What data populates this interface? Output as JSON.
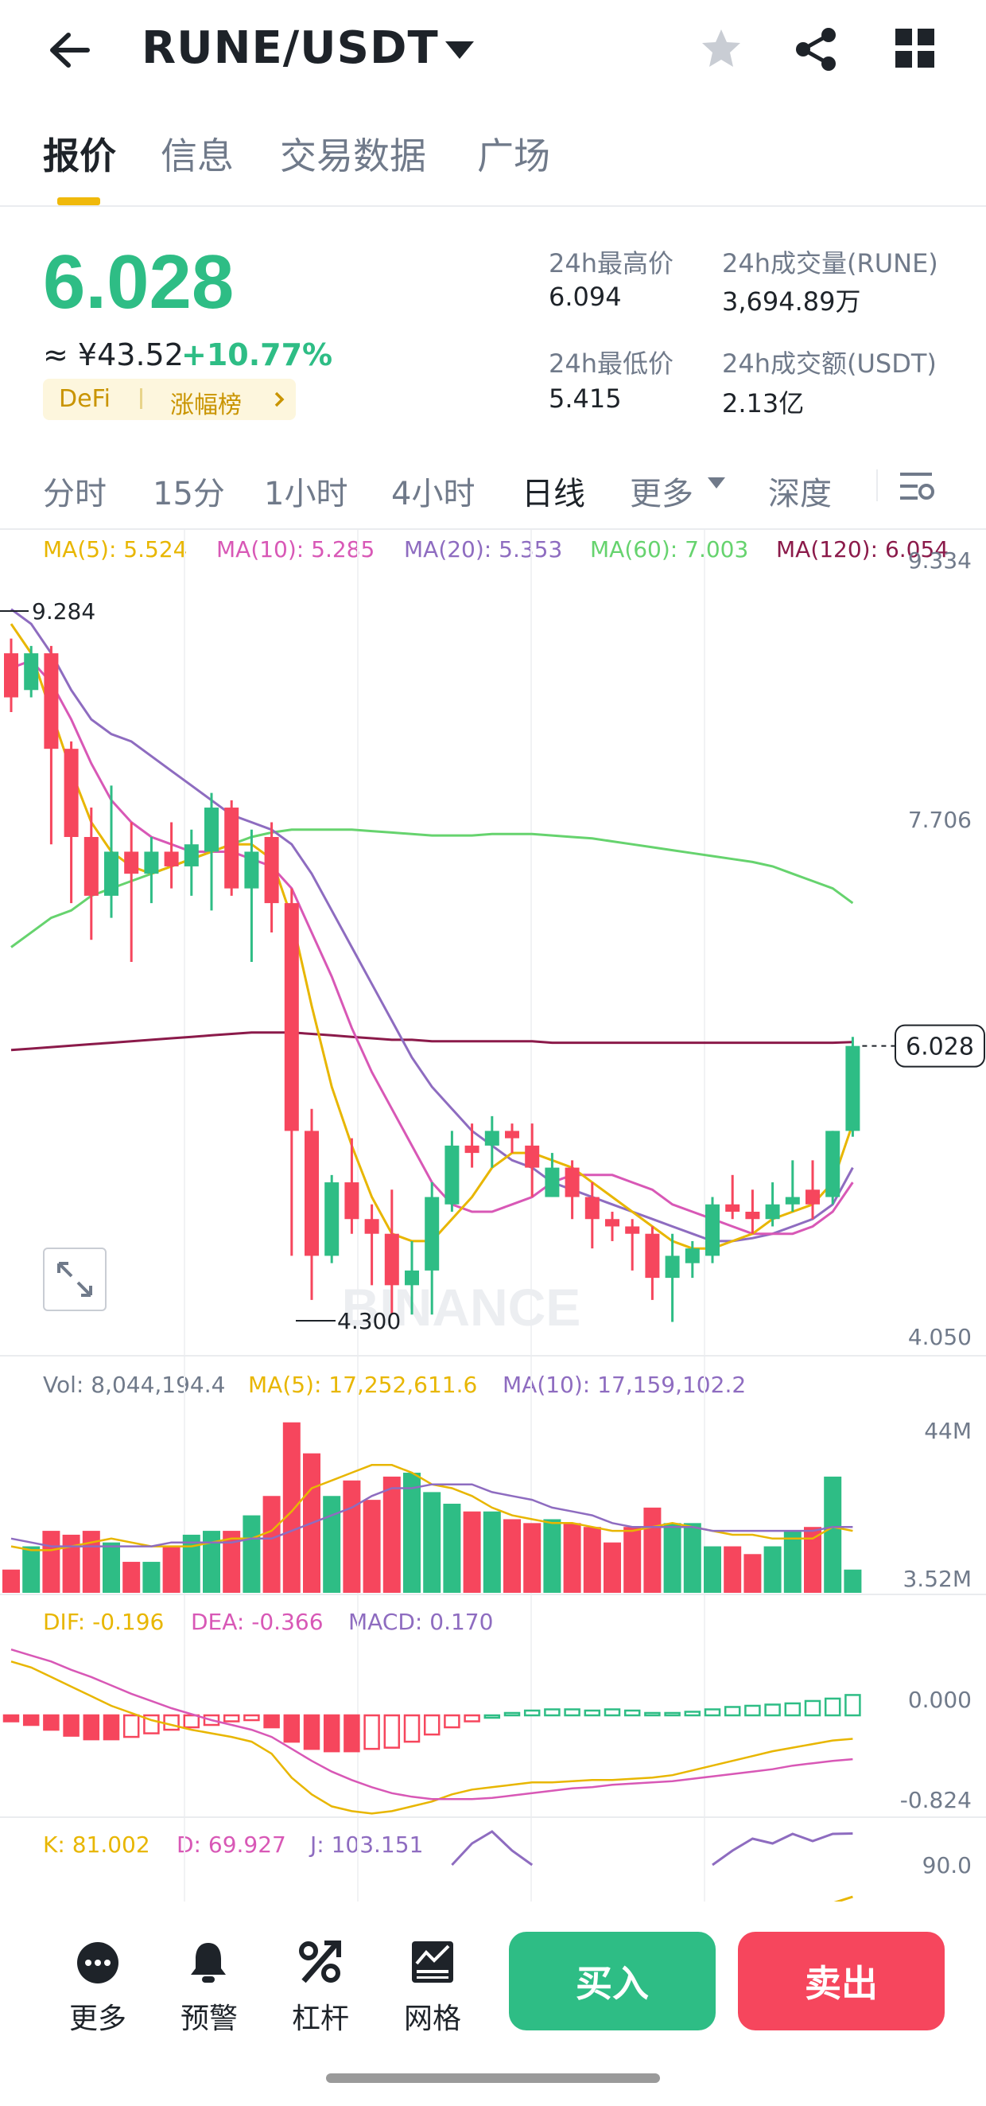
{
  "header": {
    "pair": "RUNE/USDT",
    "icons": [
      "back-arrow-icon",
      "dropdown-icon",
      "star-icon",
      "share-icon",
      "grid-icon"
    ]
  },
  "tabs": [
    {
      "label": "报价",
      "active": true
    },
    {
      "label": "信息",
      "active": false
    },
    {
      "label": "交易数据",
      "active": false
    },
    {
      "label": "广场",
      "active": false
    }
  ],
  "ticker": {
    "price": "6.028",
    "fiat": "≈ ¥43.52",
    "change": "+10.77%",
    "tag1": "DeFi",
    "tag2": "涨幅榜",
    "high_label": "24h最高价",
    "high": "6.094",
    "low_label": "24h最低价",
    "low": "5.415",
    "vol_label": "24h成交量(RUNE)",
    "vol": "3,694.89万",
    "amt_label": "24h成交额(USDT)",
    "amt": "2.13亿"
  },
  "intervals": [
    {
      "label": "分时"
    },
    {
      "label": "15分"
    },
    {
      "label": "1小时"
    },
    {
      "label": "4小时"
    },
    {
      "label": "日线",
      "active": true
    },
    {
      "label": "更多"
    },
    {
      "label": "深度"
    }
  ],
  "legend": {
    "ma5": "MA(5): 5.524",
    "ma10": "MA(10): 5.285",
    "ma20": "MA(20): 5.353",
    "ma60": "MA(60): 7.003",
    "ma120": "MA(120): 6.054",
    "vol": "Vol: 8,044,194.4",
    "vma5": "MA(5): 17,252,611.6",
    "vma10": "MA(10): 17,159,102.2",
    "dif": "DIF: -0.196",
    "dea": "DEA: -0.366",
    "macd": "MACD: 0.170",
    "k": "K: 81.002",
    "d": "D: 69.927",
    "j": "J: 103.151"
  },
  "colors": {
    "up": "#2ebd85",
    "down": "#f6465d",
    "ma5": "#e8b600",
    "ma10": "#d858b6",
    "ma20": "#8e6cc0",
    "ma60": "#66d36e",
    "ma120": "#8b1a4a",
    "accent": "#f0b90b"
  },
  "chart_data": {
    "type": "candlestick",
    "price_axis": {
      "ticks": [
        "9.334",
        "7.706",
        "6.028",
        "4.050"
      ],
      "top": "9.334",
      "bottom": "4.050"
    },
    "annotations": {
      "high": "9.284",
      "low": "4.300",
      "last": "6.028",
      "watermark": "BINANCE"
    },
    "candles": [
      {
        "o": 8.7,
        "h": 8.8,
        "c": 8.4,
        "l": 8.3
      },
      {
        "o": 8.45,
        "h": 8.75,
        "c": 8.7,
        "l": 8.4
      },
      {
        "o": 8.7,
        "h": 8.75,
        "c": 8.05,
        "l": 7.4
      },
      {
        "o": 8.05,
        "h": 8.1,
        "c": 7.45,
        "l": 7.0
      },
      {
        "o": 7.45,
        "h": 7.65,
        "c": 7.05,
        "l": 6.75
      },
      {
        "o": 7.05,
        "h": 7.8,
        "c": 7.35,
        "l": 6.9
      },
      {
        "o": 7.35,
        "h": 7.55,
        "c": 7.2,
        "l": 6.6
      },
      {
        "o": 7.2,
        "h": 7.45,
        "c": 7.35,
        "l": 7.0
      },
      {
        "o": 7.35,
        "h": 7.55,
        "c": 7.25,
        "l": 7.1
      },
      {
        "o": 7.25,
        "h": 7.5,
        "c": 7.4,
        "l": 7.05
      },
      {
        "o": 7.35,
        "h": 7.75,
        "c": 7.65,
        "l": 6.95
      },
      {
        "o": 7.65,
        "h": 7.7,
        "c": 7.1,
        "l": 7.05
      },
      {
        "o": 7.1,
        "h": 7.5,
        "c": 7.35,
        "l": 6.6
      },
      {
        "o": 7.45,
        "h": 7.55,
        "c": 7.0,
        "l": 6.8
      },
      {
        "o": 7.0,
        "h": 7.1,
        "c": 5.45,
        "l": 4.6
      },
      {
        "o": 5.45,
        "h": 5.6,
        "c": 4.6,
        "l": 4.3
      },
      {
        "o": 4.6,
        "h": 5.15,
        "c": 5.1,
        "l": 4.55
      },
      {
        "o": 5.1,
        "h": 5.4,
        "c": 4.85,
        "l": 4.75
      },
      {
        "o": 4.85,
        "h": 4.95,
        "c": 4.75,
        "l": 4.4
      },
      {
        "o": 4.75,
        "h": 5.05,
        "c": 4.4,
        "l": 4.2
      },
      {
        "o": 4.4,
        "h": 4.7,
        "c": 4.5,
        "l": 4.2
      },
      {
        "o": 4.5,
        "h": 5.1,
        "c": 5.0,
        "l": 4.2
      },
      {
        "o": 4.95,
        "h": 5.45,
        "c": 5.35,
        "l": 4.9
      },
      {
        "o": 5.35,
        "h": 5.5,
        "c": 5.3,
        "l": 5.2
      },
      {
        "o": 5.35,
        "h": 5.55,
        "c": 5.45,
        "l": 5.2
      },
      {
        "o": 5.45,
        "h": 5.5,
        "c": 5.4,
        "l": 5.3
      },
      {
        "o": 5.35,
        "h": 5.5,
        "c": 5.2,
        "l": 5.0
      },
      {
        "o": 5.0,
        "h": 5.3,
        "c": 5.2,
        "l": 5.0
      },
      {
        "o": 5.2,
        "h": 5.25,
        "c": 5.0,
        "l": 4.85
      },
      {
        "o": 5.0,
        "h": 5.1,
        "c": 4.85,
        "l": 4.65
      },
      {
        "o": 4.85,
        "h": 4.9,
        "c": 4.8,
        "l": 4.7
      },
      {
        "o": 4.8,
        "h": 4.85,
        "c": 4.75,
        "l": 4.5
      },
      {
        "o": 4.75,
        "h": 4.8,
        "c": 4.45,
        "l": 4.3
      },
      {
        "o": 4.45,
        "h": 4.75,
        "c": 4.6,
        "l": 4.15
      },
      {
        "o": 4.55,
        "h": 4.7,
        "c": 4.65,
        "l": 4.45
      },
      {
        "o": 4.6,
        "h": 5.0,
        "c": 4.95,
        "l": 4.55
      },
      {
        "o": 4.95,
        "h": 5.15,
        "c": 4.9,
        "l": 4.85
      },
      {
        "o": 4.9,
        "h": 5.05,
        "c": 4.85,
        "l": 4.75
      },
      {
        "o": 4.85,
        "h": 5.1,
        "c": 4.95,
        "l": 4.8
      },
      {
        "o": 4.95,
        "h": 5.25,
        "c": 5.0,
        "l": 4.9
      },
      {
        "o": 5.05,
        "h": 5.25,
        "c": 4.95,
        "l": 4.85
      },
      {
        "o": 5.0,
        "h": 5.45,
        "c": 5.45,
        "l": 4.95
      },
      {
        "o": 5.45,
        "h": 6.09,
        "c": 6.028,
        "l": 5.41
      }
    ],
    "ma5": [
      8.9,
      8.7,
      8.3,
      7.9,
      7.55,
      7.35,
      7.25,
      7.2,
      7.25,
      7.3,
      7.35,
      7.4,
      7.4,
      7.3,
      6.9,
      6.3,
      5.75,
      5.35,
      5.0,
      4.75,
      4.7,
      4.7,
      4.85,
      5.0,
      5.2,
      5.3,
      5.3,
      5.25,
      5.2,
      5.1,
      5.0,
      4.9,
      4.8,
      4.7,
      4.65,
      4.65,
      4.7,
      4.75,
      4.85,
      4.9,
      4.95,
      5.1,
      5.5
    ],
    "ma10": [
      8.6,
      8.65,
      8.5,
      8.25,
      7.95,
      7.7,
      7.55,
      7.45,
      7.4,
      7.35,
      7.35,
      7.35,
      7.3,
      7.25,
      7.1,
      6.8,
      6.5,
      6.15,
      5.85,
      5.6,
      5.35,
      5.1,
      4.95,
      4.9,
      4.9,
      4.95,
      5.0,
      5.1,
      5.15,
      5.15,
      5.15,
      5.1,
      5.05,
      4.95,
      4.9,
      4.85,
      4.8,
      4.75,
      4.75,
      4.75,
      4.8,
      4.9,
      5.1
    ],
    "ma20": [
      9.0,
      8.9,
      8.7,
      8.45,
      8.25,
      8.15,
      8.1,
      8.0,
      7.9,
      7.8,
      7.7,
      7.6,
      7.55,
      7.5,
      7.4,
      7.2,
      6.95,
      6.7,
      6.45,
      6.2,
      5.95,
      5.75,
      5.6,
      5.45,
      5.35,
      5.25,
      5.2,
      5.1,
      5.05,
      5.0,
      4.95,
      4.9,
      4.85,
      4.8,
      4.75,
      4.7,
      4.7,
      4.72,
      4.75,
      4.8,
      4.85,
      4.95,
      5.2
    ],
    "ma60": [
      6.7,
      6.8,
      6.9,
      6.95,
      7.05,
      7.1,
      7.15,
      7.2,
      7.25,
      7.3,
      7.35,
      7.4,
      7.45,
      7.48,
      7.5,
      7.5,
      7.5,
      7.5,
      7.49,
      7.48,
      7.47,
      7.46,
      7.46,
      7.46,
      7.47,
      7.47,
      7.47,
      7.46,
      7.45,
      7.44,
      7.42,
      7.4,
      7.38,
      7.36,
      7.34,
      7.32,
      7.3,
      7.28,
      7.25,
      7.2,
      7.15,
      7.1,
      7.0
    ],
    "ma120": [
      6.0,
      6.01,
      6.02,
      6.03,
      6.04,
      6.05,
      6.06,
      6.07,
      6.08,
      6.09,
      6.1,
      6.11,
      6.12,
      6.12,
      6.12,
      6.11,
      6.1,
      6.09,
      6.08,
      6.07,
      6.07,
      6.06,
      6.06,
      6.06,
      6.06,
      6.06,
      6.06,
      6.05,
      6.05,
      6.05,
      6.05,
      6.05,
      6.05,
      6.05,
      6.05,
      6.05,
      6.05,
      6.05,
      6.05,
      6.05,
      6.05,
      6.05,
      6.054
    ],
    "volume_axis": {
      "top": "44M",
      "bottom": "3.52M"
    },
    "volume": [
      6,
      12,
      16,
      15,
      16,
      13,
      8,
      8,
      12,
      15,
      16,
      16,
      20,
      25,
      44,
      36,
      25,
      29,
      24,
      30,
      31,
      26,
      23,
      21,
      21,
      19,
      18,
      19,
      18,
      17,
      13,
      17,
      22,
      18,
      18,
      12,
      12,
      10,
      12,
      16,
      17,
      30,
      6
    ],
    "vol_ma5": [
      12,
      11,
      11,
      12,
      13,
      14,
      13,
      12,
      12,
      12,
      13,
      14,
      14,
      16,
      21,
      27,
      29,
      31,
      33,
      33,
      31,
      28,
      27,
      25,
      22,
      20,
      19,
      18,
      18,
      17,
      16,
      16,
      17,
      18,
      17,
      16,
      15,
      15,
      14,
      14,
      14,
      17,
      16
    ],
    "vol_ma10": [
      14,
      13,
      12,
      12,
      12,
      12,
      12,
      12,
      13,
      13,
      13,
      13,
      14,
      14,
      16,
      18,
      20,
      22,
      25,
      27,
      27,
      28,
      28,
      28,
      26,
      25,
      24,
      22,
      21,
      20,
      18,
      17,
      17,
      17,
      17,
      16,
      16,
      16,
      16,
      16,
      16,
      17,
      17
    ],
    "macd_axis": {
      "top": "0.000",
      "bottom": "-0.824"
    },
    "macd_hist": [
      -0.05,
      -0.08,
      -0.12,
      -0.17,
      -0.2,
      -0.2,
      -0.18,
      -0.15,
      -0.12,
      -0.1,
      -0.08,
      -0.05,
      -0.04,
      -0.1,
      -0.22,
      -0.28,
      -0.3,
      -0.3,
      -0.28,
      -0.27,
      -0.22,
      -0.16,
      -0.1,
      -0.05,
      0.0,
      0.02,
      0.04,
      0.05,
      0.05,
      0.04,
      0.05,
      0.04,
      0.02,
      0.02,
      0.03,
      0.05,
      0.07,
      0.08,
      0.09,
      0.1,
      0.12,
      0.14,
      0.17
    ],
    "dif": [
      0.45,
      0.4,
      0.32,
      0.24,
      0.16,
      0.08,
      0.02,
      -0.04,
      -0.08,
      -0.12,
      -0.15,
      -0.18,
      -0.22,
      -0.32,
      -0.52,
      -0.66,
      -0.76,
      -0.8,
      -0.82,
      -0.8,
      -0.76,
      -0.72,
      -0.66,
      -0.62,
      -0.6,
      -0.58,
      -0.56,
      -0.56,
      -0.55,
      -0.54,
      -0.54,
      -0.53,
      -0.52,
      -0.5,
      -0.46,
      -0.42,
      -0.38,
      -0.34,
      -0.3,
      -0.27,
      -0.24,
      -0.21,
      -0.196
    ],
    "dea": [
      0.55,
      0.5,
      0.45,
      0.38,
      0.32,
      0.25,
      0.18,
      0.12,
      0.06,
      0.01,
      -0.04,
      -0.08,
      -0.12,
      -0.18,
      -0.28,
      -0.38,
      -0.47,
      -0.54,
      -0.6,
      -0.65,
      -0.68,
      -0.7,
      -0.7,
      -0.7,
      -0.69,
      -0.67,
      -0.65,
      -0.63,
      -0.61,
      -0.6,
      -0.58,
      -0.57,
      -0.56,
      -0.55,
      -0.53,
      -0.51,
      -0.49,
      -0.47,
      -0.45,
      -0.42,
      -0.4,
      -0.38,
      -0.366
    ],
    "kdj_axis": {
      "top": "90.0"
    },
    "kdj_j": [
      null,
      null,
      null,
      null,
      null,
      null,
      null,
      null,
      null,
      null,
      null,
      null,
      null,
      null,
      null,
      null,
      null,
      null,
      null,
      null,
      null,
      null,
      90,
      99,
      104,
      96,
      90,
      null,
      null,
      null,
      null,
      null,
      null,
      null,
      null,
      90,
      96,
      101,
      99,
      103,
      100,
      103,
      103.151
    ],
    "kdj_k": [
      null,
      null,
      null,
      null,
      null,
      null,
      null,
      null,
      null,
      null,
      null,
      null,
      null,
      null,
      null,
      null,
      null,
      null,
      null,
      null,
      null,
      null,
      null,
      null,
      null,
      null,
      null,
      null,
      null,
      null,
      null,
      null,
      null,
      null,
      null,
      null,
      null,
      null,
      null,
      null,
      null,
      null,
      81.0
    ]
  },
  "bottom_bar": {
    "more": "更多",
    "alert": "预警",
    "leverage": "杠杆",
    "grid": "网格",
    "buy": "买入",
    "sell": "卖出"
  }
}
